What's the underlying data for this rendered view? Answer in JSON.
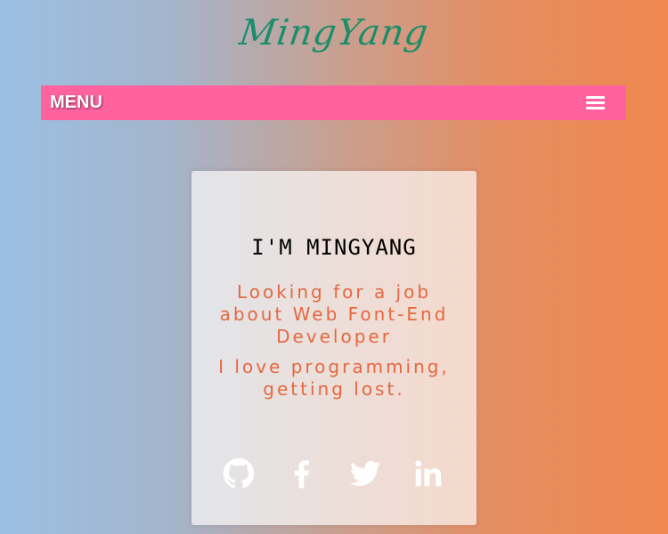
{
  "header": {
    "logo_text": "MingYang"
  },
  "nav": {
    "menu_label": "MENU",
    "menu_icon": "hamburger-icon"
  },
  "card": {
    "title": "I'M MINGYANG",
    "line1": "Looking for a job about Web Font-End Developer",
    "line2": "I love programming, getting lost."
  },
  "social": [
    {
      "icon": "github-icon"
    },
    {
      "icon": "facebook-icon"
    },
    {
      "icon": "twitter-icon"
    },
    {
      "icon": "linkedin-icon"
    }
  ],
  "colors": {
    "logo": "#1a8e6b",
    "navbar": "#ff629f",
    "accent_text": "#e4683f",
    "gradient_left": "#9bbfe3",
    "gradient_right": "#f08850"
  }
}
